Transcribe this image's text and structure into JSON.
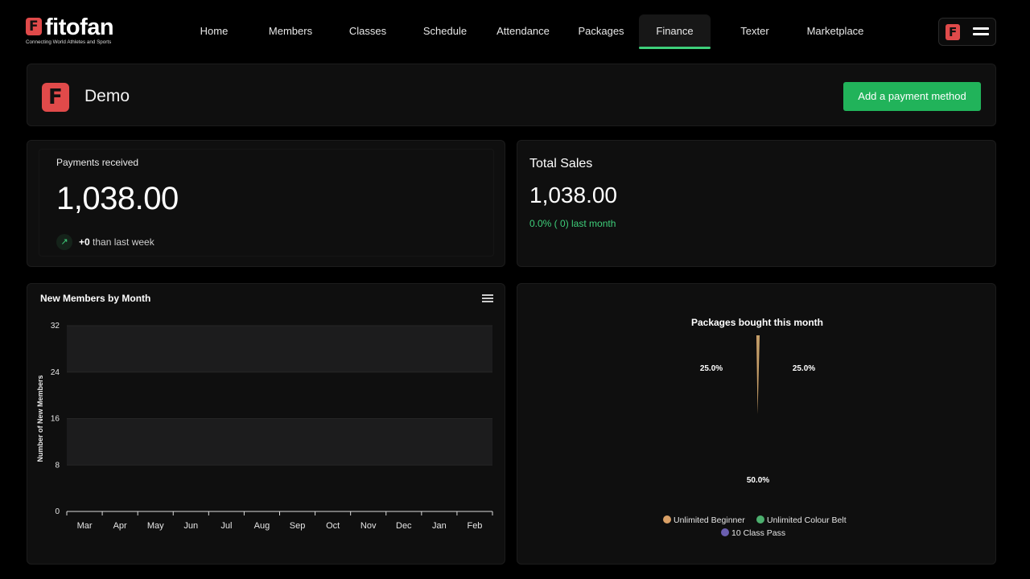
{
  "brand": {
    "name": "fitofan",
    "tagline": "Connecting World Athletes and Sports"
  },
  "nav": {
    "items": [
      {
        "label": "Home"
      },
      {
        "label": "Members"
      },
      {
        "label": "Classes"
      },
      {
        "label": "Schedule"
      },
      {
        "label": "Attendance"
      },
      {
        "label": "Packages"
      },
      {
        "label": "Finance",
        "active": true
      },
      {
        "label": "Texter"
      },
      {
        "label": "Marketplace"
      }
    ]
  },
  "header": {
    "org_name": "Demo",
    "add_payment_label": "Add a payment method"
  },
  "payments": {
    "label": "Payments received",
    "value": "1,038.00",
    "trend_value": "+0",
    "trend_suffix": " than last week"
  },
  "sales": {
    "label": "Total Sales",
    "value": "1,038.00",
    "change": "0.0% ( 0) last month"
  },
  "colors": {
    "accent": "#21b35a",
    "brand": "#e04a4a",
    "positive": "#3ecf7a"
  },
  "chart_data": [
    {
      "type": "bar",
      "title": "New Members by Month",
      "xlabel": "",
      "ylabel": "Number of New Members",
      "categories": [
        "Mar",
        "Apr",
        "May",
        "Jun",
        "Jul",
        "Aug",
        "Sep",
        "Oct",
        "Nov",
        "Dec",
        "Jan",
        "Feb"
      ],
      "values": [
        0,
        0,
        0,
        0,
        0,
        0,
        0,
        0,
        0,
        0,
        0,
        0
      ],
      "ylim": [
        0,
        32
      ],
      "yticks": [
        0,
        8,
        16,
        24,
        32
      ],
      "grid": "alternating bands"
    },
    {
      "type": "pie",
      "title": "Packages bought this month",
      "slices": [
        {
          "name": "Unlimited Beginner",
          "percent": 25.0,
          "label": "25.0%",
          "color": "#d9a066"
        },
        {
          "name": "Unlimited Colour Belt",
          "percent": 25.0,
          "label": "25.0%",
          "color": "#4caf6e"
        },
        {
          "name": "10 Class Pass",
          "percent": 50.0,
          "label": "50.0%",
          "color": "#6b5fb0"
        }
      ],
      "legend": "bottom"
    }
  ]
}
